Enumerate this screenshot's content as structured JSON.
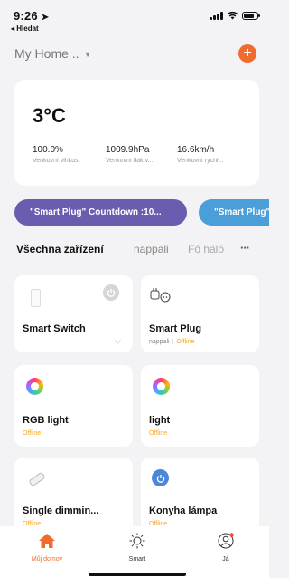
{
  "status": {
    "time": "9:26",
    "back_app": "◂ Hledat",
    "battery_level": 0.8
  },
  "home": {
    "title": "My Home ..",
    "add_label": "+"
  },
  "weather": {
    "temperature": "3°C",
    "stats": [
      {
        "value": "100.0%",
        "label": "Venkovní vlhkost"
      },
      {
        "value": "1009.9hPa",
        "label": "Venkovní tlak v..."
      },
      {
        "value": "16.6km/h",
        "label": "Venkovní rychl..."
      }
    ]
  },
  "scenes": [
    {
      "label": "\"Smart Plug\" Countdown :10...",
      "color": "#6a5cae"
    },
    {
      "label": "\"Smart Plug\"",
      "color": "#4b9fd8"
    }
  ],
  "tabs": {
    "all": "Všechna zařízení",
    "room1": "nappali",
    "room2": "Fő háló",
    "more": "···"
  },
  "devices": [
    {
      "name": "Smart Switch",
      "room": "",
      "status": "",
      "icon": "switch-icon"
    },
    {
      "name": "Smart Plug",
      "room": "nappali",
      "status": "Offline",
      "icon": "plug-icon"
    },
    {
      "name": "RGB light",
      "room": "",
      "status": "Offline",
      "icon": "rgb-bulb-icon"
    },
    {
      "name": "light",
      "room": "",
      "status": "Offline",
      "icon": "rgb-bulb-icon"
    },
    {
      "name": "Single dimmin...",
      "room": "",
      "status": "Offline",
      "icon": "dimmer-icon"
    },
    {
      "name": "Konyha lámpa",
      "room": "",
      "status": "Offline",
      "icon": "power-icon"
    }
  ],
  "tabbar": {
    "home": "Můj domov",
    "smart": "Smart",
    "me": "Já"
  },
  "colors": {
    "accent": "#f26b2e",
    "offline": "#f5a623",
    "scene1": "#6a5cae",
    "scene2": "#4b9fd8"
  }
}
